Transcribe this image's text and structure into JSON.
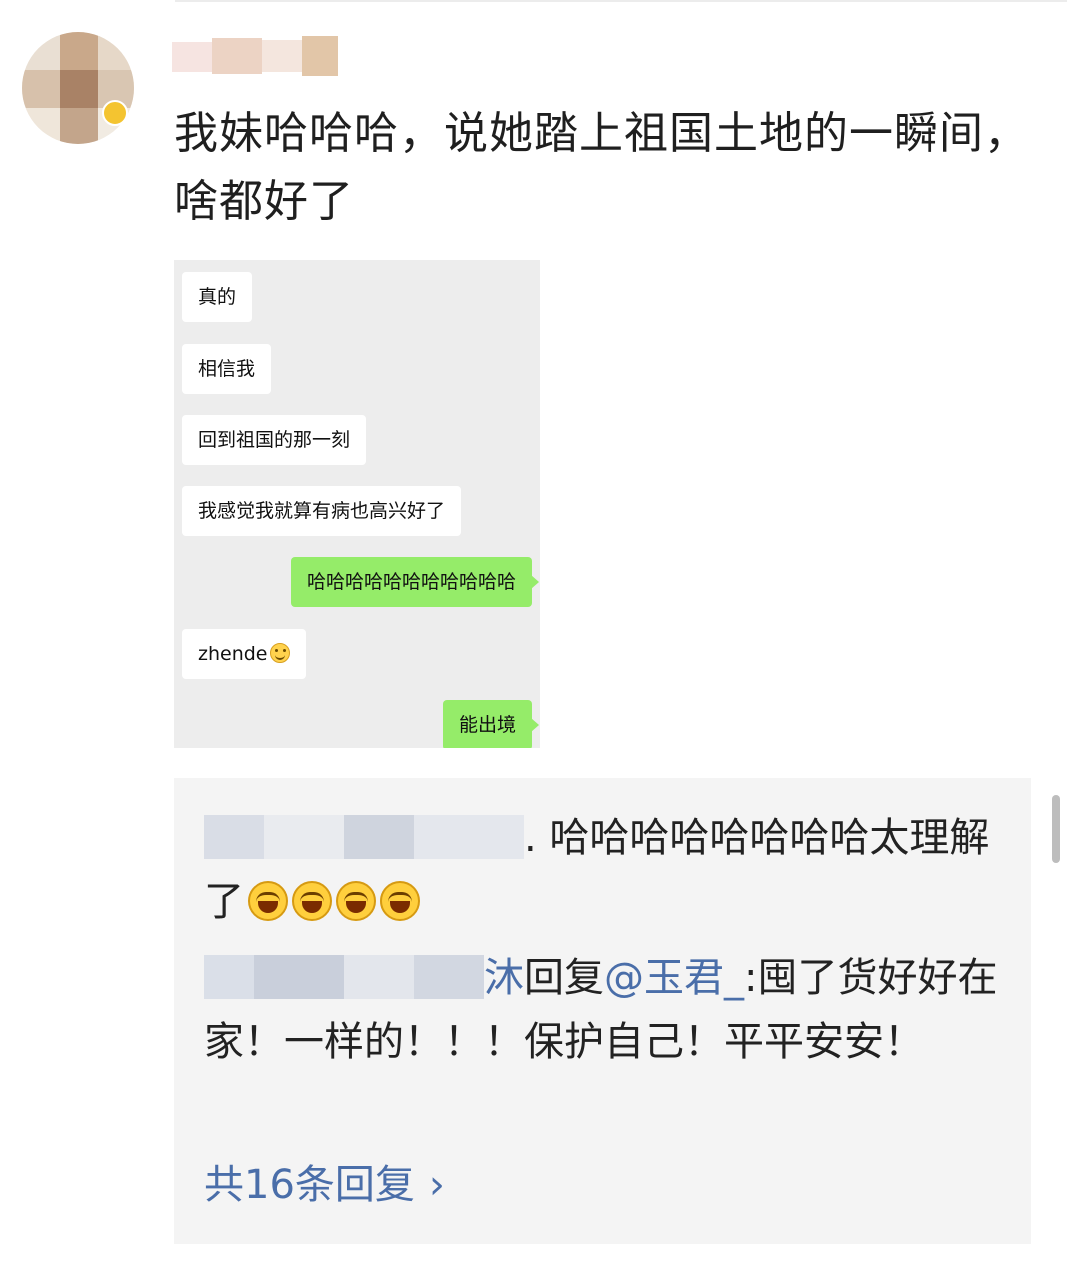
{
  "post": {
    "text": "我妹哈哈哈，说她踏上祖国土地的一瞬间，啥都好了"
  },
  "chat_screenshot": {
    "messages": [
      {
        "side": "in",
        "text": "真的"
      },
      {
        "side": "in",
        "text": "相信我"
      },
      {
        "side": "in",
        "text": "回到祖国的那一刻"
      },
      {
        "side": "in",
        "text": "我感觉我就算有病也高兴好了"
      },
      {
        "side": "out",
        "text": "哈哈哈哈哈哈哈哈哈哈哈"
      },
      {
        "side": "in",
        "text": "zhende"
      },
      {
        "side": "out",
        "text": "能出境"
      }
    ]
  },
  "replies": {
    "first": {
      "name_tail": "",
      "text": ". 哈哈哈哈哈哈哈哈太理解了"
    },
    "second": {
      "name_tail": "沐",
      "reply_word": "回复",
      "mention": "@玉君_",
      "text": ":囤了货好好在家！一样的！！！保护自己！平平安安！"
    },
    "more_label": "共16条回复",
    "more_chevron": "›"
  },
  "colors": {
    "link": "#4a6ea9",
    "sent_bubble": "#95ec69",
    "chat_bg": "#ededed",
    "reply_bg": "#f4f4f4"
  }
}
